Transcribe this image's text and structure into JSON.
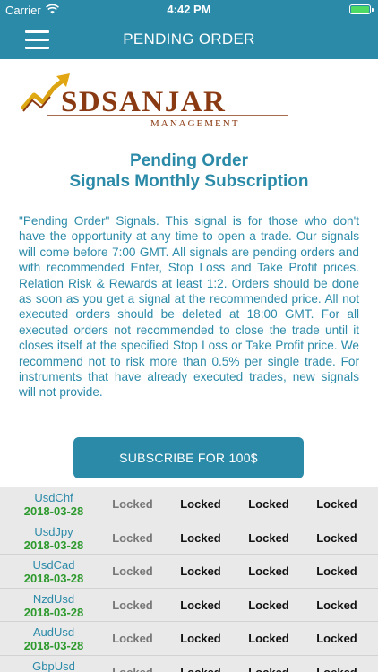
{
  "status": {
    "carrier": "Carrier",
    "time": "4:42 PM"
  },
  "nav": {
    "title": "PENDING ORDER"
  },
  "logo": {
    "brand": "SDSANJAR",
    "sub": "MANAGEMENT",
    "brand_color": "#8a3a12"
  },
  "heading": {
    "line1": "Pending Order",
    "line2": "Signals Monthly Subscription"
  },
  "description": "\"Pending Order\" Signals. This signal is for those who don't have the opportunity at any time to open a trade. Our signals will come before 7:00 GMT. All signals are pending orders and with recommended Enter, Stop Loss and Take Profit prices. Relation Risk & Rewards at least 1:2. Orders should be done as soon as you get a signal at the recommended price. All not executed orders should be deleted at 18:00 GMT. For all executed orders not recommended to close the trade until it closes itself at the specified Stop Loss or Take Profit price. We recommend not to risk more than 0.5% per single trade. For instruments that have already executed trades, new signals will not provide.",
  "subscribe_label": "SUBSCRIBE FOR 100$",
  "colors": {
    "accent": "#2b8aa8",
    "date_green": "#2e9a2e",
    "row_bg": "#e9e9e9"
  },
  "signals": [
    {
      "pair": "UsdChf",
      "date": "2018-03-28",
      "cells": [
        "Locked",
        "Locked",
        "Locked",
        "Locked"
      ]
    },
    {
      "pair": "UsdJpy",
      "date": "2018-03-28",
      "cells": [
        "Locked",
        "Locked",
        "Locked",
        "Locked"
      ]
    },
    {
      "pair": "UsdCad",
      "date": "2018-03-28",
      "cells": [
        "Locked",
        "Locked",
        "Locked",
        "Locked"
      ]
    },
    {
      "pair": "NzdUsd",
      "date": "2018-03-28",
      "cells": [
        "Locked",
        "Locked",
        "Locked",
        "Locked"
      ]
    },
    {
      "pair": "AudUsd",
      "date": "2018-03-28",
      "cells": [
        "Locked",
        "Locked",
        "Locked",
        "Locked"
      ]
    },
    {
      "pair": "GbpUsd",
      "date": "",
      "cells": [
        "Locked",
        "Locked",
        "Locked",
        "Locked"
      ]
    }
  ]
}
